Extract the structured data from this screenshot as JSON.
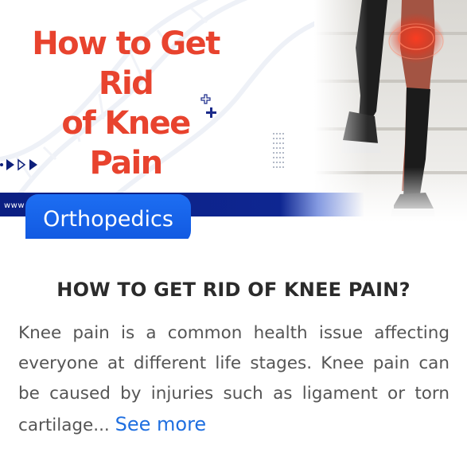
{
  "banner": {
    "headline_line1": "How to Get Rid",
    "headline_line2": "of Knee Pain",
    "www": "www",
    "category": "Orthopedics",
    "accent_color": "#e8432e",
    "strip_color": "#0e2691",
    "badge_color": "#1565e6"
  },
  "article": {
    "title": "HOW TO GET RID OF KNEE PAIN?",
    "excerpt": "Knee pain is a common health issue affecting everyone at different life stages. Knee pain can be caused by injuries such as ligament or torn cartilage...",
    "see_more": "See more",
    "link_color": "#1f6fe0"
  },
  "icons": [
    "dna-helix-icon",
    "plus-icon",
    "arrow-right-icon",
    "dot-grid-icon"
  ]
}
